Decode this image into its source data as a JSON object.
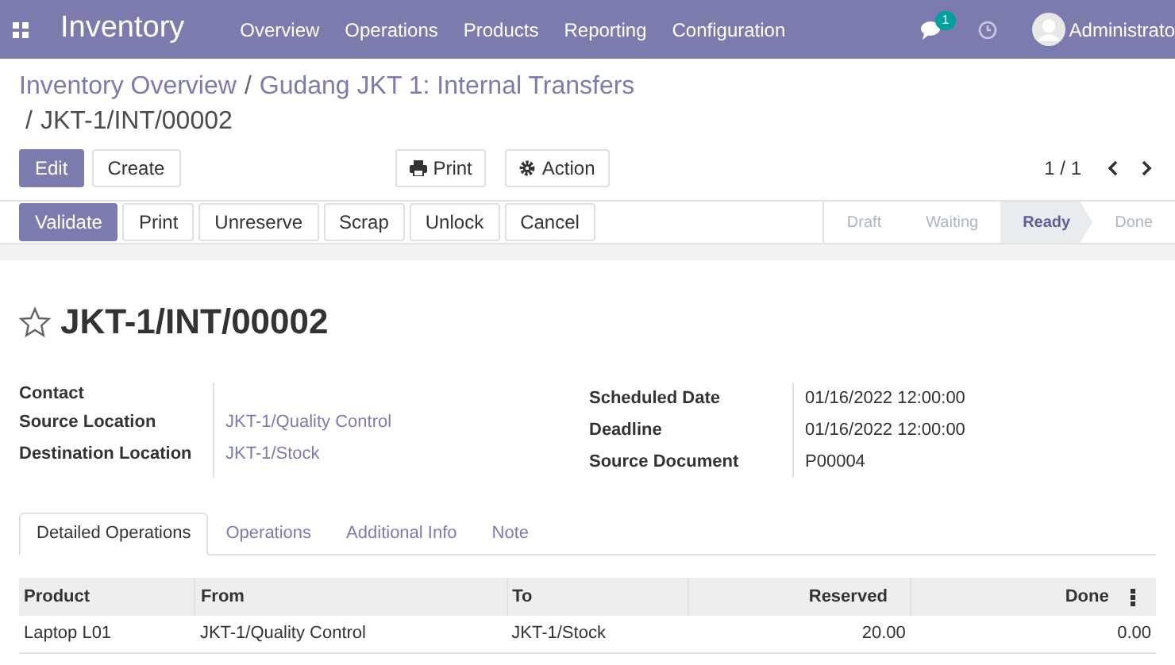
{
  "navbar": {
    "app_name": "Inventory",
    "menu": [
      "Overview",
      "Operations",
      "Products",
      "Reporting",
      "Configuration"
    ],
    "messages_badge": "1",
    "user": "Administrato"
  },
  "breadcrumb": {
    "links": [
      "Inventory Overview",
      "Gudang JKT 1: Internal Transfers"
    ],
    "separator": "/",
    "current": "JKT-1/INT/00002"
  },
  "control_buttons": [
    {
      "label": "Edit",
      "kind": "primary"
    },
    {
      "label": "Create",
      "kind": "secondary"
    }
  ],
  "center_buttons": [
    {
      "label": "Print",
      "kind": "print"
    },
    {
      "label": "Action",
      "kind": "action"
    }
  ],
  "pager": "1 / 1",
  "action_buttons": [
    {
      "label": "Validate",
      "kind": "primary"
    },
    {
      "label": "Print",
      "kind": "secondary"
    },
    {
      "label": "Unreserve",
      "kind": "secondary"
    },
    {
      "label": "Scrap",
      "kind": "secondary"
    },
    {
      "label": "Unlock",
      "kind": "secondary"
    },
    {
      "label": "Cancel",
      "kind": "secondary"
    }
  ],
  "statusbar": [
    {
      "label": "Draft",
      "selected": false
    },
    {
      "label": "Waiting",
      "selected": false
    },
    {
      "label": "Ready",
      "selected": true
    },
    {
      "label": "Done",
      "selected": false
    }
  ],
  "record": {
    "title": "JKT-1/INT/00002",
    "starred": false
  },
  "left_fields": [
    {
      "label": "Contact"
    },
    {
      "label": "Source Location",
      "value": "JKT-1/Quality Control"
    },
    {
      "label": "Destination Location",
      "value": "JKT-1/Stock"
    }
  ],
  "right_fields": [
    {
      "label": "Scheduled Date",
      "value": "01/16/2022 12:00:00"
    },
    {
      "label": "Deadline",
      "value": "01/16/2022 12:00:00"
    },
    {
      "label": "Source Document",
      "value": "P00004"
    }
  ],
  "tabs": [
    {
      "label": "Detailed Operations",
      "selected": true
    },
    {
      "label": "Operations",
      "selected": false
    },
    {
      "label": "Additional Info",
      "selected": false
    },
    {
      "label": "Note",
      "selected": false
    }
  ],
  "table": {
    "columns": [
      "Product",
      "From",
      "To",
      "Reserved",
      "Done"
    ],
    "rows": [
      [
        "Laptop L01",
        "JKT-1/Quality Control",
        "JKT-1/Stock",
        "20.00",
        "0.00"
      ]
    ]
  }
}
